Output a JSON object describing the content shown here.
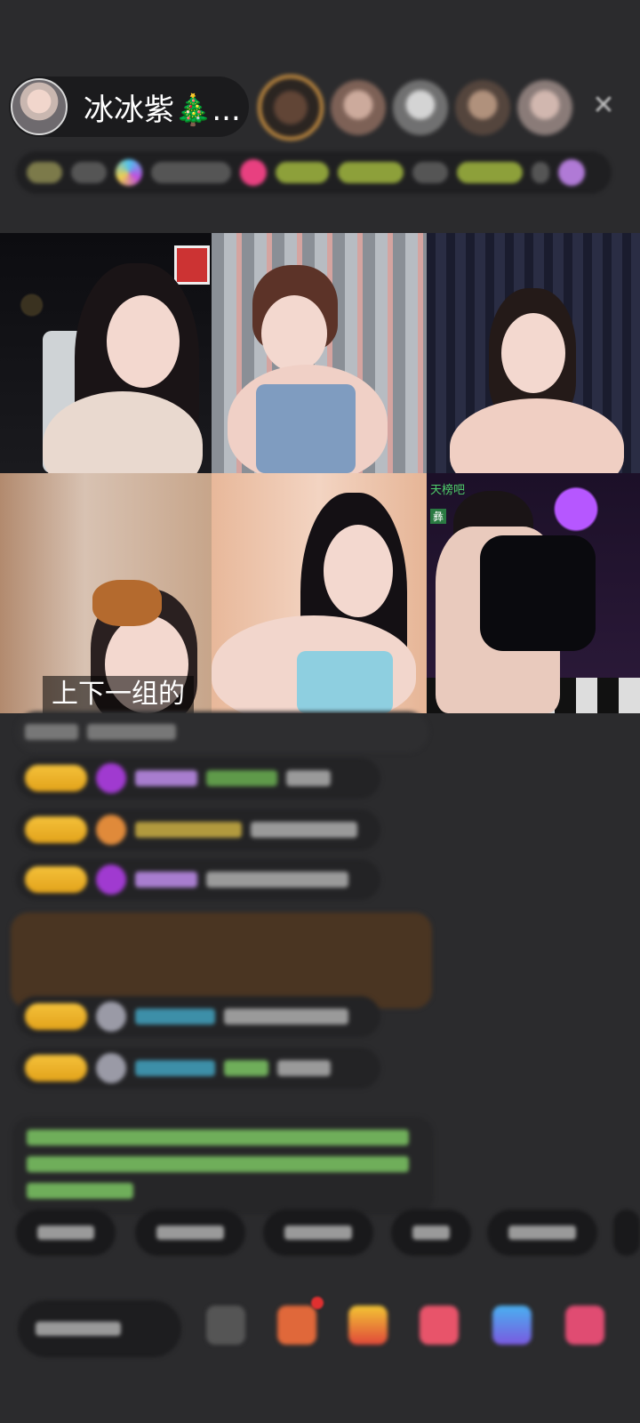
{
  "header": {
    "host_name": "冰冰紫🎄...",
    "close_icon": "✕"
  },
  "grid": {
    "cell4_caption": "上下一组的",
    "cell6_rank_label": "天榜吧",
    "cell6_rank_name": "彝"
  },
  "colors": {
    "background": "#2b2b2d",
    "badge_gold": "#f4c13a",
    "highlight_message": "#4a3522",
    "green_text": "#6fae5a"
  }
}
